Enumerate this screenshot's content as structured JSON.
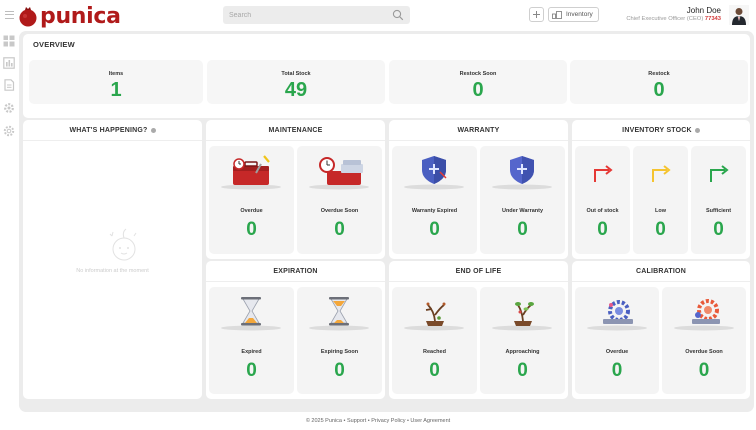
{
  "app": {
    "name": "punica"
  },
  "search": {
    "placeholder": "Search",
    "value": ""
  },
  "header": {
    "inventory_label": "Inventory"
  },
  "user": {
    "name": "John Doe",
    "role": "Chief Executive Officer (CEO)",
    "id": "77343"
  },
  "overview": {
    "title": "OVERVIEW",
    "stats": [
      {
        "label": "Items",
        "value": "1"
      },
      {
        "label": "Total Stock",
        "value": "49"
      },
      {
        "label": "Restock Soon",
        "value": "0"
      },
      {
        "label": "Restock",
        "value": "0"
      }
    ]
  },
  "happening": {
    "title": "WHAT'S HAPPENING?",
    "empty_message": "No information at the moment"
  },
  "maintenance": {
    "title": "MAINTENANCE",
    "items": [
      {
        "label": "Overdue",
        "value": "0"
      },
      {
        "label": "Overdue Soon",
        "value": "0"
      }
    ]
  },
  "warranty": {
    "title": "WARRANTY",
    "items": [
      {
        "label": "Warranty Expired",
        "value": "0"
      },
      {
        "label": "Under Warranty",
        "value": "0"
      }
    ]
  },
  "inventory_stock": {
    "title": "INVENTORY STOCK",
    "items": [
      {
        "label": "Out of stock",
        "value": "0"
      },
      {
        "label": "Low",
        "value": "0"
      },
      {
        "label": "Sufficient",
        "value": "0"
      }
    ]
  },
  "expiration": {
    "title": "EXPIRATION",
    "items": [
      {
        "label": "Expired",
        "value": "0"
      },
      {
        "label": "Expiring Soon",
        "value": "0"
      }
    ]
  },
  "end_of_life": {
    "title": "END OF LIFE",
    "items": [
      {
        "label": "Reached",
        "value": "0"
      },
      {
        "label": "Approaching",
        "value": "0"
      }
    ]
  },
  "calibration": {
    "title": "CALIBRATION",
    "items": [
      {
        "label": "Overdue",
        "value": "0"
      },
      {
        "label": "Overdue Soon",
        "value": "0"
      }
    ]
  },
  "footer": {
    "text": "© 2025 Punica • Support • Privacy Policy • User Agreement"
  },
  "colors": {
    "brand": "#b01a1a",
    "value_green": "#2aa64d",
    "panel_bg": "#ececec"
  },
  "icons": {
    "sidebar": [
      "dashboard-icon",
      "chart-icon",
      "document-icon",
      "gear-icon",
      "settings-icon"
    ],
    "header": [
      "menu-icon",
      "search-icon",
      "add-icon",
      "inventory-icon",
      "avatar"
    ]
  }
}
